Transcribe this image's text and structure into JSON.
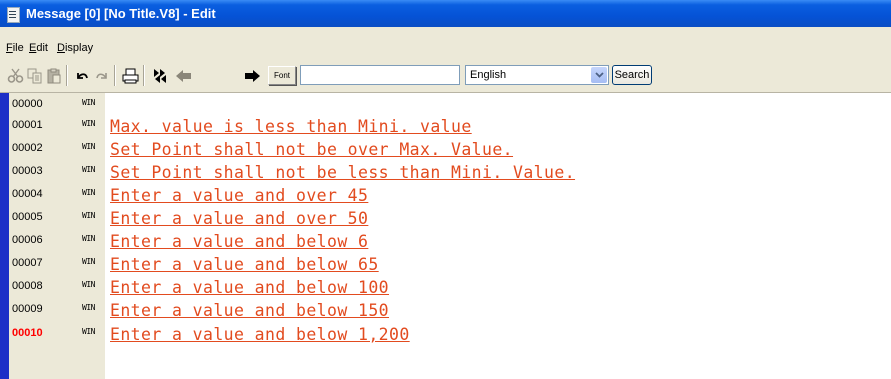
{
  "window": {
    "title": "Message [0] [No Title.V8] - Edit"
  },
  "menu": {
    "items": [
      {
        "mnemonic": "F",
        "rest": "ile"
      },
      {
        "mnemonic": "E",
        "rest": "dit"
      },
      {
        "mnemonic": "D",
        "rest": "isplay"
      }
    ]
  },
  "toolbar": {
    "buttons": [
      "cut-icon",
      "copy-icon",
      "paste-icon",
      "undo-icon",
      "redo-icon",
      "print-icon",
      "jump-icon",
      "previous-icon",
      "next-icon"
    ],
    "font_label": "Font",
    "search_value": "",
    "language_selected": "English",
    "search_label": "Search"
  },
  "messages": [
    {
      "id": "00000",
      "tag": "WIN",
      "text": ""
    },
    {
      "id": "00001",
      "tag": "WIN",
      "text": "Max. value is less than Mini. value"
    },
    {
      "id": "00002",
      "tag": "WIN",
      "text": "Set Point shall not be over Max. Value."
    },
    {
      "id": "00003",
      "tag": "WIN",
      "text": "Set Point shall not be less than Mini. Value."
    },
    {
      "id": "00004",
      "tag": "WIN",
      "text": "Enter a value and over 45"
    },
    {
      "id": "00005",
      "tag": "WIN",
      "text": "Enter a value and over 50"
    },
    {
      "id": "00006",
      "tag": "WIN",
      "text": "Enter a value and below 6"
    },
    {
      "id": "00007",
      "tag": "WIN",
      "text": "Enter a value and below 65"
    },
    {
      "id": "00008",
      "tag": "WIN",
      "text": "Enter a value and below 100"
    },
    {
      "id": "00009",
      "tag": "WIN",
      "text": "Enter a value and below 150"
    },
    {
      "id": "00010",
      "tag": "WIN",
      "text": "Enter a value and below 1,200"
    }
  ],
  "colors": {
    "message_text": "#e24b1f",
    "active_row_number": "#ff0000",
    "titlebar": "#0552d6"
  }
}
